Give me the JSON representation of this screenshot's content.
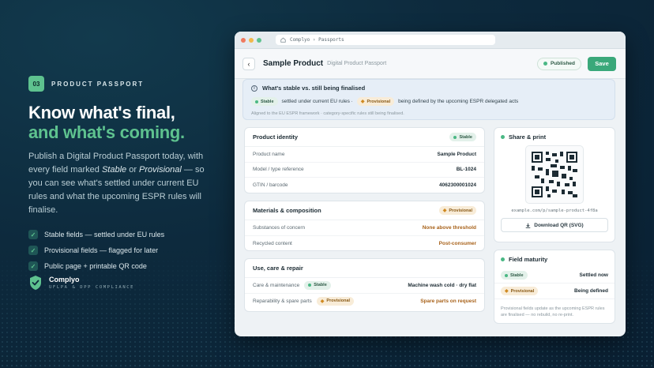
{
  "step": {
    "number": "03",
    "label": "PRODUCT PASSPORT"
  },
  "headline": {
    "line1": "Know what's final,",
    "line2": "and what's coming."
  },
  "description": {
    "p1": "Publish a Digital Product Passport today, with every field marked ",
    "stable": "Stable",
    "or": " or ",
    "provisional": "Provisional",
    "p2": " — so you can see what's settled under current EU rules and what the upcoming ESPR rules will finalise."
  },
  "features": [
    "Stable fields — settled under EU rules",
    "Provisional fields — flagged for later",
    "Public page + printable QR code"
  ],
  "brand": {
    "name": "Complyo",
    "tagline": "UFLPA & DPP COMPLIANCE"
  },
  "browser": {
    "address": "Complyo › Passports"
  },
  "header": {
    "title": "Sample Product",
    "subtitle": "Digital Product Passport",
    "status": "Published",
    "save_label": "Save"
  },
  "info": {
    "title": "What's stable vs. still being finalised",
    "stable_label": "Stable",
    "stable_text": "settled under current EU rules ·",
    "provisional_label": "Provisional",
    "provisional_text": "being defined by the upcoming ESPR delegated acts",
    "note": "Aligned to the EU ESPR framework · category-specific rules still being finalised."
  },
  "identity": {
    "title": "Product identity",
    "badge": "Stable",
    "rows": [
      {
        "label": "Product name",
        "value": "Sample Product"
      },
      {
        "label": "Model / type reference",
        "value": "BL-1024"
      },
      {
        "label": "GTIN / barcode",
        "value": "4062300001024"
      }
    ]
  },
  "materials": {
    "title": "Materials & composition",
    "badge": "Provisional",
    "rows": [
      {
        "label": "Substances of concern",
        "value": "None above threshold"
      },
      {
        "label": "Recycled content",
        "value": "Post-consumer"
      }
    ]
  },
  "care": {
    "title": "Use, care & repair",
    "rows": [
      {
        "label": "Care & maintenance",
        "badge": "Stable",
        "value": "Machine wash cold · dry flat"
      },
      {
        "label": "Reparability & spare parts",
        "badge": "Provisional",
        "value": "Spare parts on request"
      }
    ]
  },
  "share": {
    "title": "Share & print",
    "url": "example.com/p/sample-product-4f8a",
    "download_label": "Download QR (SVG)"
  },
  "maturity": {
    "title": "Field maturity",
    "rows": [
      {
        "badge": "Stable",
        "value": "Settled now"
      },
      {
        "badge": "Provisional",
        "value": "Being defined"
      }
    ],
    "note": "Provisional fields update as the upcoming ESPR rules are finalised — no rebuild, no re-print."
  },
  "colors": {
    "accent": "#5ec28f",
    "save": "#3aa87a",
    "provisional": "#a8621a",
    "background": "#0d2a3d"
  }
}
